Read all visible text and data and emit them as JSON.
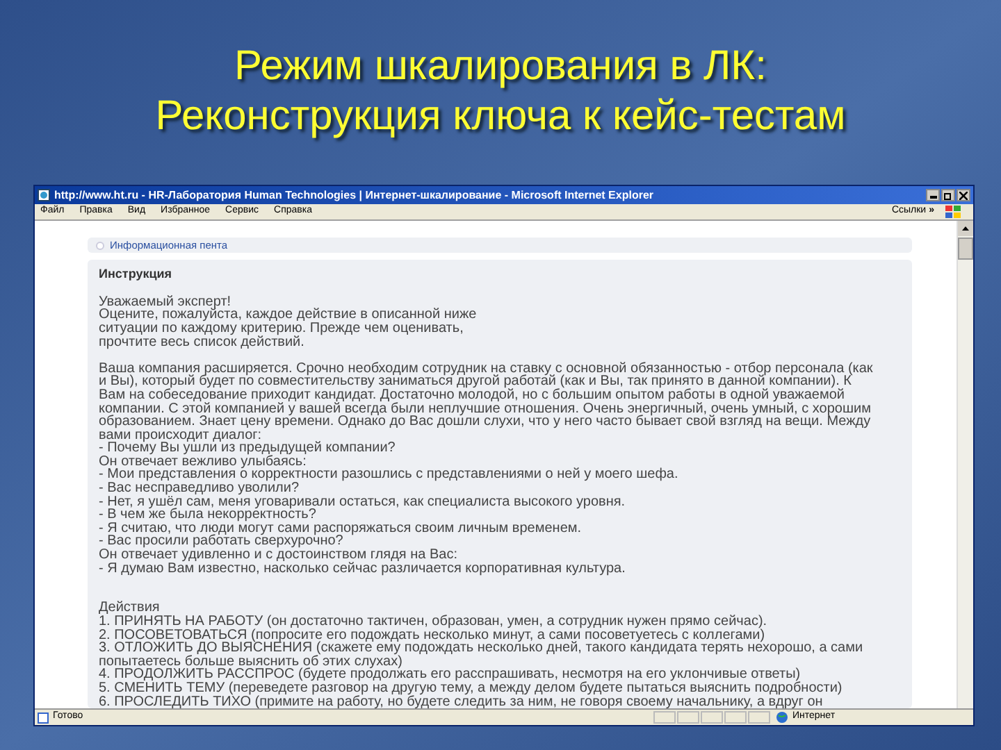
{
  "slide_title": [
    "Режим шкалирования в ЛК:",
    "Реконструкция ключа к кейс-тестам"
  ],
  "window": {
    "title": "http://www.ht.ru - HR-Лаборатория Human Technologies | Интернет-шкалирование - Microsoft Internet Explorer"
  },
  "menu": [
    "Файл",
    "Правка",
    "Вид",
    "Избранное",
    "Сервис",
    "Справка"
  ],
  "links_label": "Ссылки",
  "links_chevron": "»",
  "info_feed": "Информационная пента",
  "instruction": {
    "heading": "Инструкция",
    "greeting": [
      "Уважаемый эксперт!",
      "Оцените, пожалуйста, каждое действие в описанной ниже",
      "ситуации по каждому критерию. Прежде чем оценивать,",
      "прочтите весь список действий."
    ],
    "case": [
      "Ваша компания расширяется. Срочно необходим сотрудник на ставку с основной обязанностью - отбор персонала (как",
      "и Вы), который будет по совместительству заниматься другой работай (как и Вы, так принято в данной компании). К",
      "Вам на собеседование приходит кандидат. Достаточно молодой, но с большим опытом работы в одной уважаемой",
      "компании. С этой компанией у вашей всегда были неплучшие отношения. Очень энергичный, очень умный, с хорошим",
      "образованием. Знает цену времени. Однако до Вас дошли слухи, что у него часто бывает свой взгляд на вещи. Между",
      "вами происходит диалог:",
      "- Почему Вы ушли из предыдущей компании?",
      "Он отвечает вежливо улыбаясь:",
      "- Мои представления о корректности разошлись с представлениями о ней у моего шефа.",
      "- Вас несправедливо уволили?",
      "- Нет, я ушёл сам, меня уговаривали остаться, как специалиста высокого уровня.",
      "- В чем же была некорректность?",
      "- Я считаю, что люди могут сами распоряжаться своим личным временем.",
      "- Вас просили работать сверхурочно?",
      "Он отвечает удивленно и с достоинством глядя на Вас:",
      "- Я думаю Вам известно, насколько сейчас различается корпоративная культура."
    ],
    "actions_heading": "Действия",
    "actions": [
      "1. ПРИНЯТЬ НА РАБОТУ (он достаточно тактичен, образован, умен, а сотрудник нужен прямо сейчас).",
      "2. ПОСОВЕТОВАТЬСЯ (попросите его подождать несколько минут, а сами посоветуетесь с коллегами)",
      "3. ОТЛОЖИТЬ ДО ВЫЯСНЕНИЯ (скажете ему подождать несколько дней, такого кандидата терять нехорошо, а сами",
      "попытаетесь больше выяснить об этих слухах)",
      "4. ПРОДОЛЖИТЬ РАССПРОС (будете продолжать его расспрашивать, несмотря на его уклончивые ответы)",
      "5. СМЕНИТЬ ТЕМУ (переведете разговор на другую тему, а между делом будете пытаться выяснить подробности)",
      "6. ПРОСЛЕДИТЬ ТИХО (примите на работу, но будете следить за ним, не говоря своему начальнику, а вдруг он"
    ]
  },
  "status_bar": {
    "text": "Готово",
    "zone": "Интернет"
  }
}
